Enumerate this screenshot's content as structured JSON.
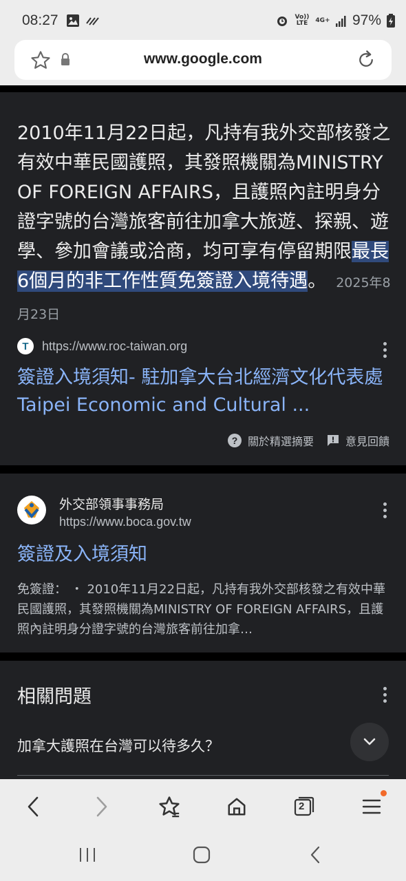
{
  "status_bar": {
    "time": "08:27",
    "volte": "Vo)) LTE",
    "network": "4G+",
    "battery": "97%"
  },
  "browser": {
    "url": "www.google.com"
  },
  "featured_snippet": {
    "text_before": "2010年11月22日起，凡持有我外交部核發之有效中華民國護照，其發照機關為MINISTRY OF FOREIGN AFFAIRS，且護照內註明身分證字號的台灣旅客前往加拿大旅遊、探親、遊學、參加會議或洽商，均可享有停留期限",
    "text_highlight": "最長6個月的非工作性質免簽證入境待遇",
    "text_after": "。",
    "date": "2025年8月23日",
    "source_icon_letter": "T",
    "source_url": "https://www.roc-taiwan.org",
    "link_title": "簽證入境須知- 駐加拿大台北經濟文化代表處Taipei Economic and Cultural ...",
    "about_label": "關於精選摘要",
    "feedback_label": "意見回饋"
  },
  "result": {
    "site_name": "外交部領事事務局",
    "site_url": "https://www.boca.gov.tw",
    "title": "簽證及入境須知",
    "desc_label": "免簽證：",
    "desc": " ・ 2010年11月22日起，凡持有我外交部核發之有效中華民國護照，其發照機關為MINISTRY OF FOREIGN AFFAIRS，且護照內註明身分證字號的台灣旅客前往加拿…"
  },
  "related_questions": {
    "title": "相關問題",
    "items": [
      "加拿大護照在台灣可以待多久？"
    ]
  },
  "bottom_nav": {
    "tab_count": "2"
  }
}
